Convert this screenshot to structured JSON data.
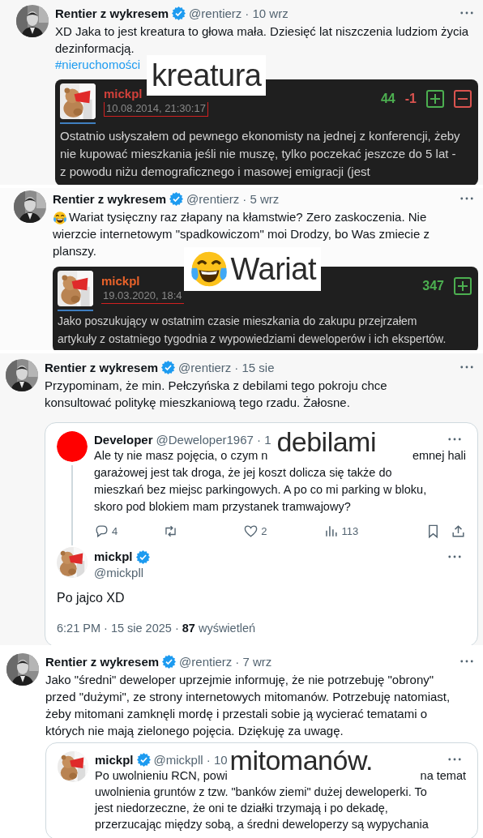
{
  "panels": [
    {
      "kind": "dark_quote",
      "author": {
        "name": "Rentier z wykresem",
        "verified": true,
        "handle": "@rentierz",
        "time": "· 10 wrz"
      },
      "text": "XD Jaka to jest kreatura to głowa mała. Dziesięć lat niszczenia ludziom życia dezinformacją.",
      "hashtag": "#nieruchomości",
      "overlay": {
        "text": "kreatura"
      },
      "quote": {
        "user": "mickpl",
        "color": "#d0403a",
        "date": "10.08.2014, 21:30:17",
        "votes": [
          {
            "kind": "up",
            "text": "44"
          },
          {
            "kind": "down",
            "text": "-1"
          }
        ],
        "buttons": [
          {
            "kind": "up"
          },
          {
            "kind": "down"
          }
        ],
        "text": "Ostatnio usłyszałem od pewnego ekonomisty na jednej z konferencji, żeby nie kupować mieszkania jeśli nie muszę, tylko poczekać jeszcze do 5 lat - z powodu niżu demograficznego i masowej emigracji (jest"
      }
    },
    {
      "kind": "dark_quote",
      "author": {
        "name": "Rentier z wykresem",
        "verified": true,
        "handle": "@rentierz",
        "time": "· 5 wrz"
      },
      "emoji": true,
      "text": "Wariat tysięczny raz złapany na kłamstwie? Zero zaskoczenia. Nie wierzcie internetowym \"spadkowiczom\" moi Drodzy, bo Was zmiecie z planszy.",
      "overlay": {
        "text": "Wariat",
        "emoji": true
      },
      "quote": {
        "user": "mickpl",
        "color": "#e8622a",
        "date": "19.03.2020, 18:4",
        "votes": [
          {
            "kind": "up",
            "text": "347"
          }
        ],
        "buttons": [
          {
            "kind": "up"
          }
        ],
        "text": "Jako poszukujący w ostatnim czasie mieszkania do zakupu przejrzałem artykuły z ostatniego tygodnia z wypowiedziami deweloperów i ich ekspertów."
      }
    },
    {
      "kind": "thread_quote",
      "author": {
        "name": "Rentier z wykresem",
        "verified": true,
        "handle": "@rentierz",
        "time": "· 15 sie"
      },
      "text": "Przypominam, że min. Pełczyńska z debilami tego pokroju chce konsultować politykę mieszkaniową tego rzadu. Żałosne.",
      "overlay": {
        "text": "debilami"
      },
      "quote": {
        "avatar": {
          "color": "#ff0000"
        },
        "name": "Developer",
        "handle": "@Deweloper1967 · 1",
        "lines": [
          {
            "left": "Ale ty nie masz pojęcia, o czym n",
            "right": "emnej hali"
          },
          "garażowej jest tak droga, że jej koszt dolicza się także do",
          "mieszkań bez miejsc parkingowych. A po co mi parking w bloku,",
          "skoro pod blokiem mam przystanek tramwajowy?"
        ],
        "actions": [
          {
            "kind": "reply",
            "count": "4"
          },
          {
            "kind": "repost"
          },
          {
            "kind": "like",
            "count": "2"
          },
          {
            "kind": "views",
            "count": "113"
          },
          {
            "kind": "bookmark"
          },
          {
            "kind": "share"
          }
        ]
      },
      "reply": {
        "name": "mickpl",
        "verified": true,
        "handle": "@mickpll",
        "text": "Po jajco XD",
        "footer": "6:21 PM · 15 sie 2025 · **87** wyświetleń"
      }
    },
    {
      "kind": "card_quote",
      "author": {
        "name": "Rentier z wykresem",
        "verified": true,
        "handle": "@rentierz",
        "time": "· 7 wrz"
      },
      "text": "Jako \"średni\" deweloper uprzejmie informuję, że nie potrzebuję \"obrony\" przed \"dużymi\", ze strony internetowych mitomanów. Potrzebuję natomiast, żeby mitomani zamknęli mordę i przestali sobie ją wycierać tematami o których nie mają zielonego pojęcia. Dziękuję za uwagę.",
      "overlay": {
        "text": "mitomanów."
      },
      "quote": {
        "name": "mickpl",
        "verified": true,
        "handle": "@mickpll · 10",
        "lines": [
          {
            "left": "Po uwolnieniu RCN, powi",
            "right": "na temat"
          },
          "uwolnienia gruntów z tzw. \"banków ziemi\" dużej deweloperki. To",
          "jest niedorzeczne, że oni te działki trzymają i po dekadę,",
          "przerzucając między sobą, a średni deweloperzy są wypychania"
        ]
      }
    }
  ]
}
